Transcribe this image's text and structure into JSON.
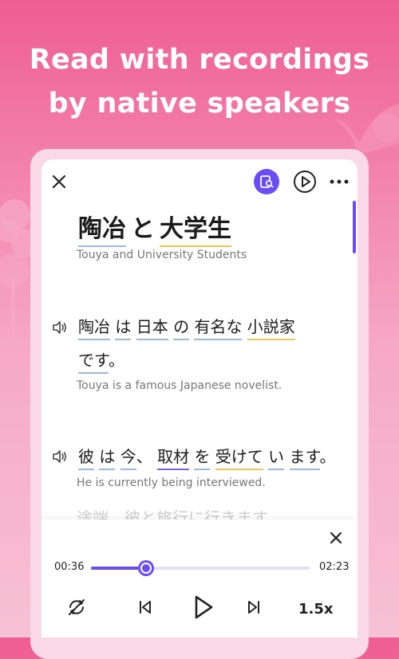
{
  "headline": {
    "line1": "Read with recordings",
    "line2": "by native speakers"
  },
  "reader": {
    "title_words": [
      "陶冶",
      "と",
      "大学生"
    ],
    "subtitle": "Touya and University Students",
    "sentences": [
      {
        "line1_words": [
          "陶冶",
          "は",
          "日本",
          "の",
          "有名",
          "な",
          "小説家"
        ],
        "line2_words": [
          "です",
          "。"
        ],
        "translation": "Touya is a famous Japanese novelist."
      },
      {
        "line1_words": [
          "彼",
          "は",
          "今",
          "、",
          "取材",
          "を",
          "受けて",
          "い",
          "ます",
          "。"
        ],
        "translation": "He is currently being interviewed."
      }
    ],
    "faded_text": "途端、彼と旅行に行きます"
  },
  "player": {
    "current_time": "00:36",
    "total_time": "02:23",
    "progress": 0.25,
    "speed": "1.5x"
  },
  "colors": {
    "accent": "#6a4ef5",
    "background_top": "#ef5d93",
    "underline_blue": "#9fb7e4",
    "underline_yellow": "#f0c65b"
  },
  "icons": [
    "close-icon",
    "lookup-icon",
    "play-circle-icon",
    "more-icon",
    "speaker-icon",
    "loop-off-icon",
    "previous-icon",
    "play-icon",
    "next-icon"
  ]
}
